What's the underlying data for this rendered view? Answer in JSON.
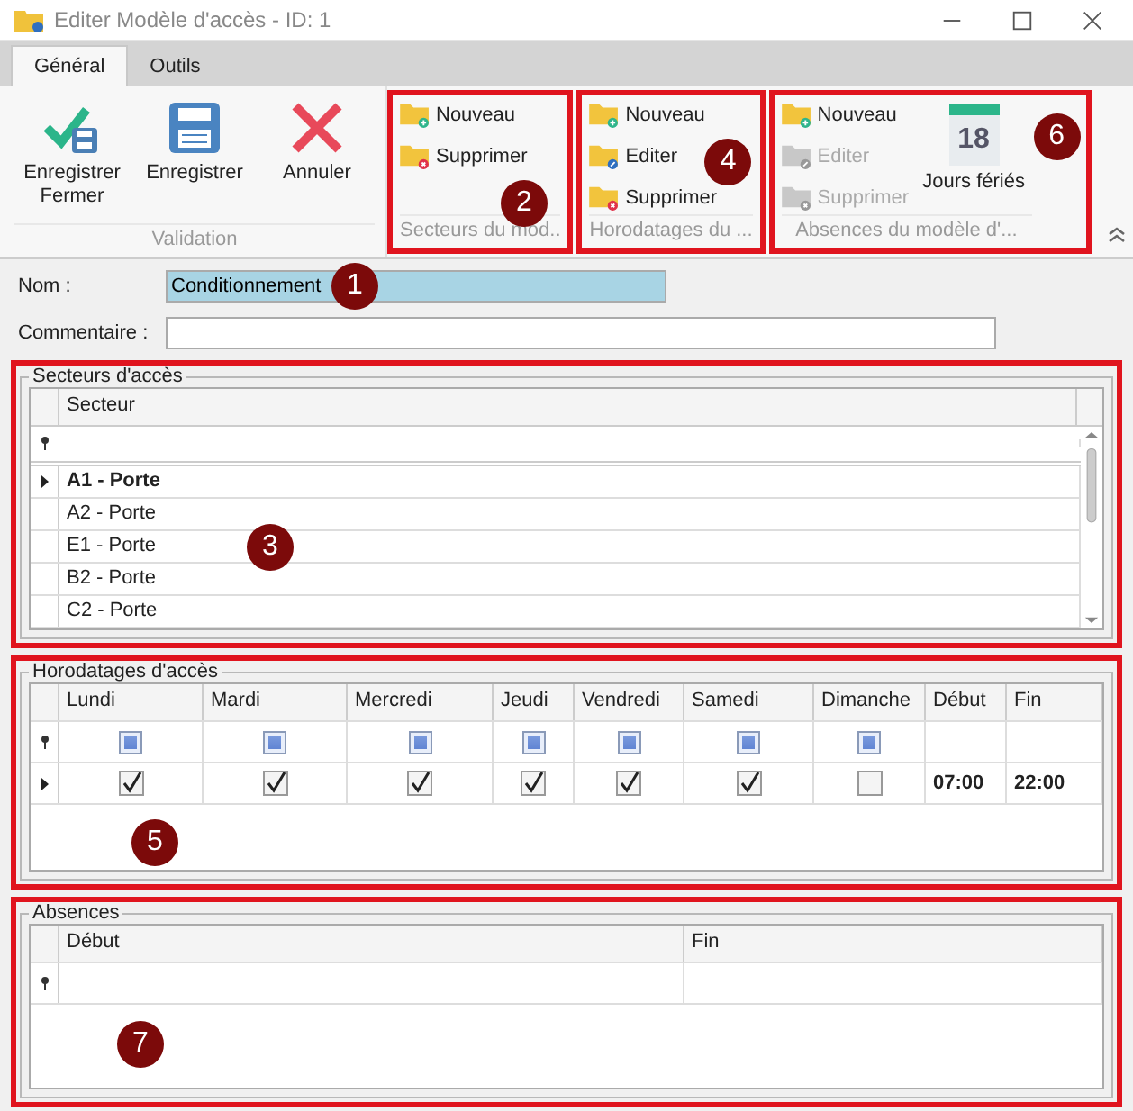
{
  "window": {
    "title": "Editer Modèle d'accès - ID: 1"
  },
  "tabs": [
    {
      "label": "Général",
      "selected": true
    },
    {
      "label": "Outils",
      "selected": false
    }
  ],
  "ribbon": {
    "groups": [
      {
        "label": "Validation",
        "highlighted": false,
        "buttons": [
          {
            "kind": "save-close",
            "label": "Enregistrer Fermer",
            "disabled": false
          },
          {
            "kind": "save",
            "label": "Enregistrer",
            "disabled": false
          },
          {
            "kind": "cancel",
            "label": "Annuler",
            "disabled": false
          }
        ]
      },
      {
        "label": "Secteurs du mod..",
        "highlighted": true,
        "callout": "2",
        "buttons": [
          {
            "kind": "new",
            "label": "Nouveau",
            "disabled": false
          },
          {
            "kind": "delete",
            "label": "Supprimer",
            "disabled": false
          }
        ]
      },
      {
        "label": "Horodatages du ...",
        "highlighted": true,
        "callout": "4",
        "buttons": [
          {
            "kind": "new",
            "label": "Nouveau",
            "disabled": false
          },
          {
            "kind": "edit",
            "label": "Editer",
            "disabled": false
          },
          {
            "kind": "delete",
            "label": "Supprimer",
            "disabled": false
          }
        ]
      },
      {
        "label": "Absences du modèle d'...",
        "highlighted": true,
        "callout": "6",
        "buttons": [
          {
            "kind": "new",
            "label": "Nouveau",
            "disabled": false
          },
          {
            "kind": "edit",
            "label": "Editer",
            "disabled": true
          },
          {
            "kind": "delete",
            "label": "Supprimer",
            "disabled": true
          },
          {
            "kind": "holidays",
            "label": "Jours fériés",
            "icon_text": "18",
            "disabled": false
          }
        ]
      }
    ]
  },
  "form": {
    "name": {
      "label": "Nom :",
      "value": "Conditionnement",
      "callout": "1"
    },
    "comment": {
      "label": "Commentaire :"
    }
  },
  "sectors": {
    "title": "Secteurs d'accès",
    "highlighted": true,
    "callout": "3",
    "columns": [
      "Secteur"
    ],
    "rows": [
      {
        "name": "A1 - Porte",
        "selected": true
      },
      {
        "name": "A2 - Porte",
        "selected": false
      },
      {
        "name": "E1 - Porte",
        "selected": false
      },
      {
        "name": "B2 - Porte",
        "selected": false
      },
      {
        "name": "C2 - Porte",
        "selected": false
      }
    ]
  },
  "timestamps": {
    "title": "Horodatages d'accès",
    "highlighted": true,
    "callout": "5",
    "columns": [
      "Lundi",
      "Mardi",
      "Mercredi",
      "Jeudi",
      "Vendredi",
      "Samedi",
      "Dimanche",
      "Début",
      "Fin"
    ],
    "filter_days": [
      {
        "kind": "mixed"
      },
      {
        "kind": "mixed"
      },
      {
        "kind": "mixed"
      },
      {
        "kind": "mixed"
      },
      {
        "kind": "mixed"
      },
      {
        "kind": "mixed"
      },
      {
        "kind": "mixed"
      }
    ],
    "rows": [
      {
        "selected": true,
        "days": [
          true,
          true,
          true,
          true,
          true,
          true,
          false
        ],
        "start": "07:00",
        "end": "22:00"
      }
    ]
  },
  "absences": {
    "title": "Absences",
    "highlighted": true,
    "callout": "7",
    "columns": [
      "Début",
      "Fin"
    ]
  }
}
